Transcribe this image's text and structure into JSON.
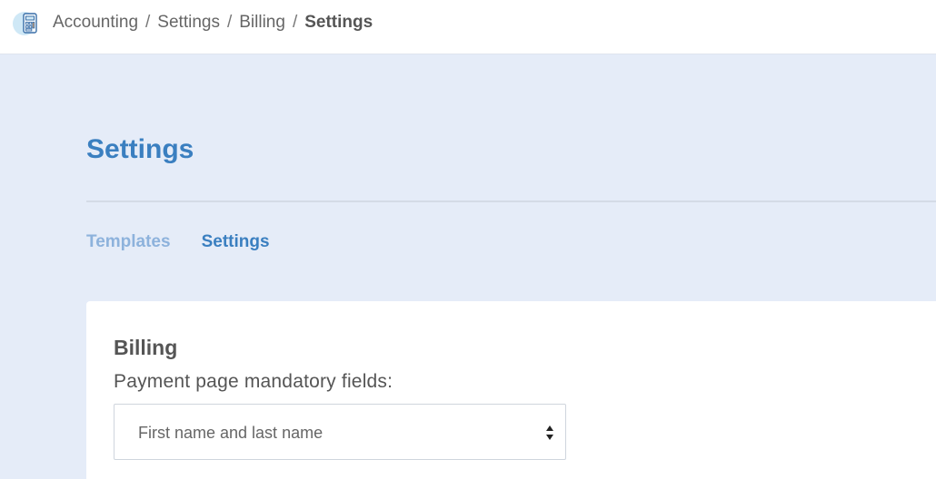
{
  "breadcrumb": {
    "items": [
      "Accounting",
      "Settings",
      "Billing"
    ],
    "current": "Settings",
    "separator": "/"
  },
  "app_icon": "calculator-icon",
  "page": {
    "title": "Settings"
  },
  "tabs": [
    {
      "label": "Templates",
      "active": false
    },
    {
      "label": "Settings",
      "active": true
    }
  ],
  "billing": {
    "title": "Billing",
    "mandatory_fields_label": "Payment page mandatory fields:",
    "mandatory_fields_value": "First name and last name"
  },
  "colors": {
    "background": "#e5ecf8",
    "accent": "#3a7fc0",
    "tab_inactive": "#8db2dc"
  }
}
